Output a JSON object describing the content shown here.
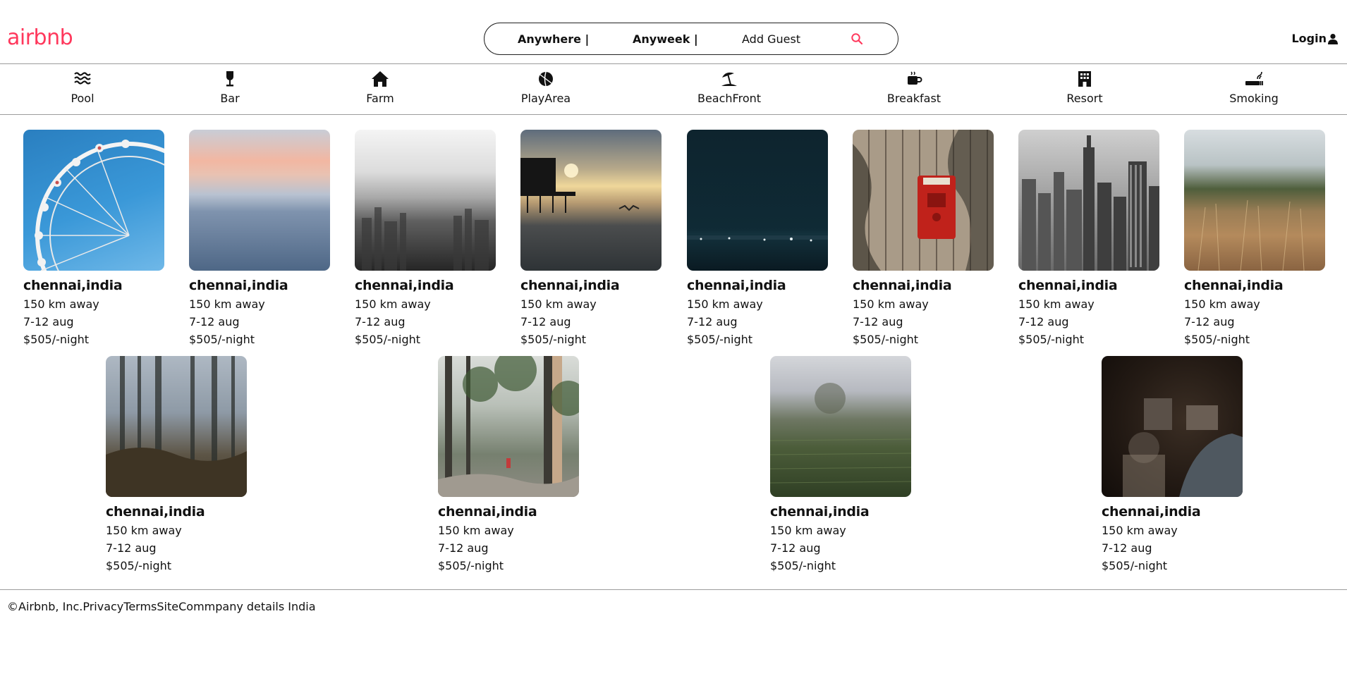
{
  "header": {
    "logo": "airbnb",
    "brand_color": "#FF385C",
    "search": {
      "where": "Anywhere |",
      "when": "Anyweek |",
      "guests": "Add Guest",
      "icon": "search-icon"
    },
    "login_label": "Login",
    "login_icon": "user-icon"
  },
  "categories": [
    {
      "label": "Pool",
      "icon": "waves-icon"
    },
    {
      "label": "Bar",
      "icon": "wine-glass-icon"
    },
    {
      "label": "Farm",
      "icon": "house-icon"
    },
    {
      "label": "PlayArea",
      "icon": "ball-icon"
    },
    {
      "label": "BeachFront",
      "icon": "umbrella-beach-icon"
    },
    {
      "label": "Breakfast",
      "icon": "mug-icon"
    },
    {
      "label": "Resort",
      "icon": "building-icon"
    },
    {
      "label": "Smoking",
      "icon": "cigarette-icon"
    }
  ],
  "listings": [
    {
      "title": "chennai,india",
      "distance": "150 km away",
      "dates": "7-12 aug",
      "price": "$505/-night",
      "photo": "ferris-wheel"
    },
    {
      "title": "chennai,india",
      "distance": "150 km away",
      "dates": "7-12 aug",
      "price": "$505/-night",
      "photo": "misty-sea-sunset"
    },
    {
      "title": "chennai,india",
      "distance": "150 km away",
      "dates": "7-12 aug",
      "price": "$505/-night",
      "photo": "foggy-city-bw"
    },
    {
      "title": "chennai,india",
      "distance": "150 km away",
      "dates": "7-12 aug",
      "price": "$505/-night",
      "photo": "pier-sunset"
    },
    {
      "title": "chennai,india",
      "distance": "150 km away",
      "dates": "7-12 aug",
      "price": "$505/-night",
      "photo": "night-shore"
    },
    {
      "title": "chennai,india",
      "distance": "150 km away",
      "dates": "7-12 aug",
      "price": "$505/-night",
      "photo": "red-fire-alarm"
    },
    {
      "title": "chennai,india",
      "distance": "150 km away",
      "dates": "7-12 aug",
      "price": "$505/-night",
      "photo": "skyline-bw"
    },
    {
      "title": "chennai,india",
      "distance": "150 km away",
      "dates": "7-12 aug",
      "price": "$505/-night",
      "photo": "dry-grass"
    },
    {
      "title": "chennai,india",
      "distance": "150 km away",
      "dates": "7-12 aug",
      "price": "$505/-night",
      "photo": "misty-forest"
    },
    {
      "title": "chennai,india",
      "distance": "150 km away",
      "dates": "7-12 aug",
      "price": "$505/-night",
      "photo": "forest-walker"
    },
    {
      "title": "chennai,india",
      "distance": "150 km away",
      "dates": "7-12 aug",
      "price": "$505/-night",
      "photo": "foggy-field"
    },
    {
      "title": "chennai,india",
      "distance": "150 km away",
      "dates": "7-12 aug",
      "price": "$505/-night",
      "photo": "old-machine"
    }
  ],
  "footer": {
    "text": "©Airbnb, Inc.PrivacyTermsSiteCommpany details India"
  }
}
